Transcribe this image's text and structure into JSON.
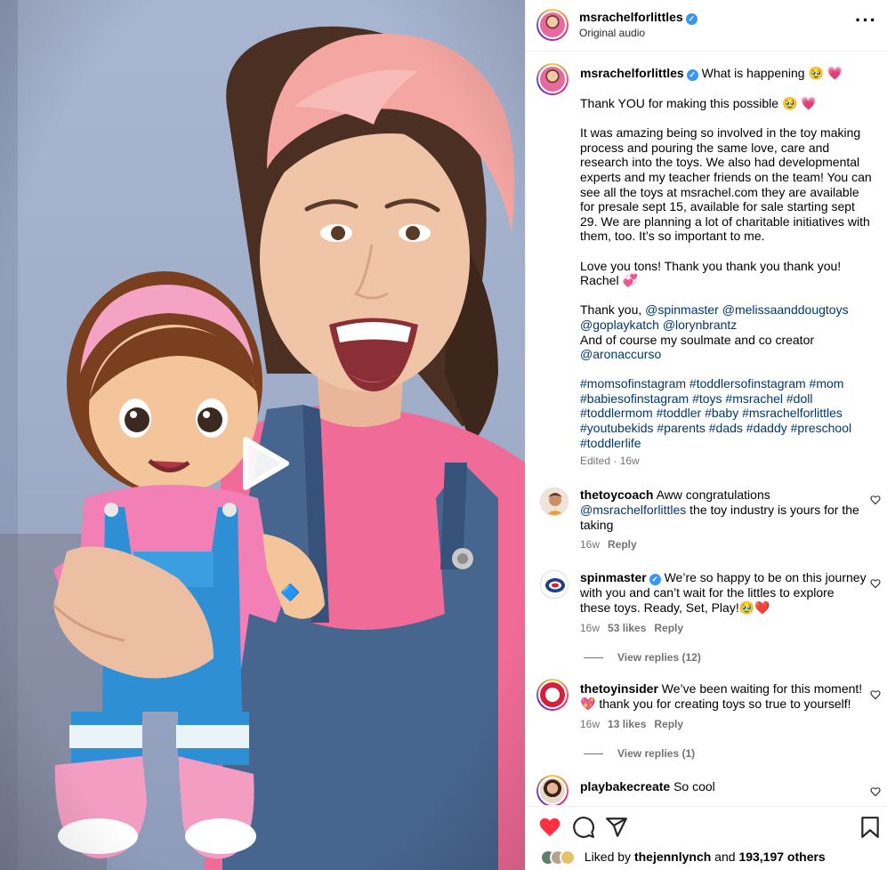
{
  "post": {
    "username": "msrachelforlittles",
    "audio": "Original audio"
  },
  "caption": {
    "username": "msrachelforlittles",
    "headline": "What is happening 🥹 💗",
    "p1": "Thank YOU for making this possible 🥹 💗",
    "p2": "It was amazing being so involved in the toy making process and pouring the same love, care and research into the toys. We also had developmental experts and my teacher friends on the team! You can see all the toys at msrachel.com they are available for presale sept 15, available for sale starting sept 29. We are planning a lot of charitable initiatives with them, too. It’s so important to me.",
    "p3": "Love you tons! Thank you thank you thank you!\nRachel 💞",
    "p4_prefix": "Thank you, ",
    "p4_mentions_a": "@spinmaster @melissaanddougtoys\n@goplaykatch @lorynbrantz",
    "p4_middle": "\nAnd of course my soulmate and co creator\n",
    "p4_mention_b": "@aronaccurso",
    "hashtags": "#momsofinstagram #toddlersofinstagram #mom #babiesofinstagram #toys #msrachel #doll #toddlermom #toddler #baby #msrachelforlittles #youtubekids #parents #dads #daddy #preschool #toddlerlife",
    "meta": "Edited · 16w"
  },
  "comments": [
    {
      "username": "thetoycoach",
      "text_before": " Aww congratulations",
      "mention": "@msrachelforlittles",
      "text_after": " the toy industry is yours for the taking",
      "age": "16w",
      "likes": "",
      "reply": "Reply"
    },
    {
      "username": "spinmaster",
      "text": " We’re so happy to be on this journey with you and can’t wait for the littles to explore these toys. Ready, Set, Play!🥹❤️",
      "age": "16w",
      "likes": "53 likes",
      "reply": "Reply",
      "view_replies": "View replies (12)"
    },
    {
      "username": "thetoyinsider",
      "text": " We’ve been waiting for this moment! 💖 thank you for creating toys so true to yourself!",
      "age": "16w",
      "likes": "13 likes",
      "reply": "Reply",
      "view_replies": "View replies (1)"
    },
    {
      "username": "playbakecreate",
      "text": " So cool"
    }
  ],
  "footer": {
    "liked_by_prefix": "Liked by ",
    "liked_by_user": "thejennlynch",
    "liked_by_middle": " and ",
    "liked_by_count": "193,197 others"
  },
  "colors": {
    "like_red": "#ff3040",
    "link_blue": "#00376b",
    "verified_blue": "#3897f0",
    "secondary_gray": "#737373"
  }
}
